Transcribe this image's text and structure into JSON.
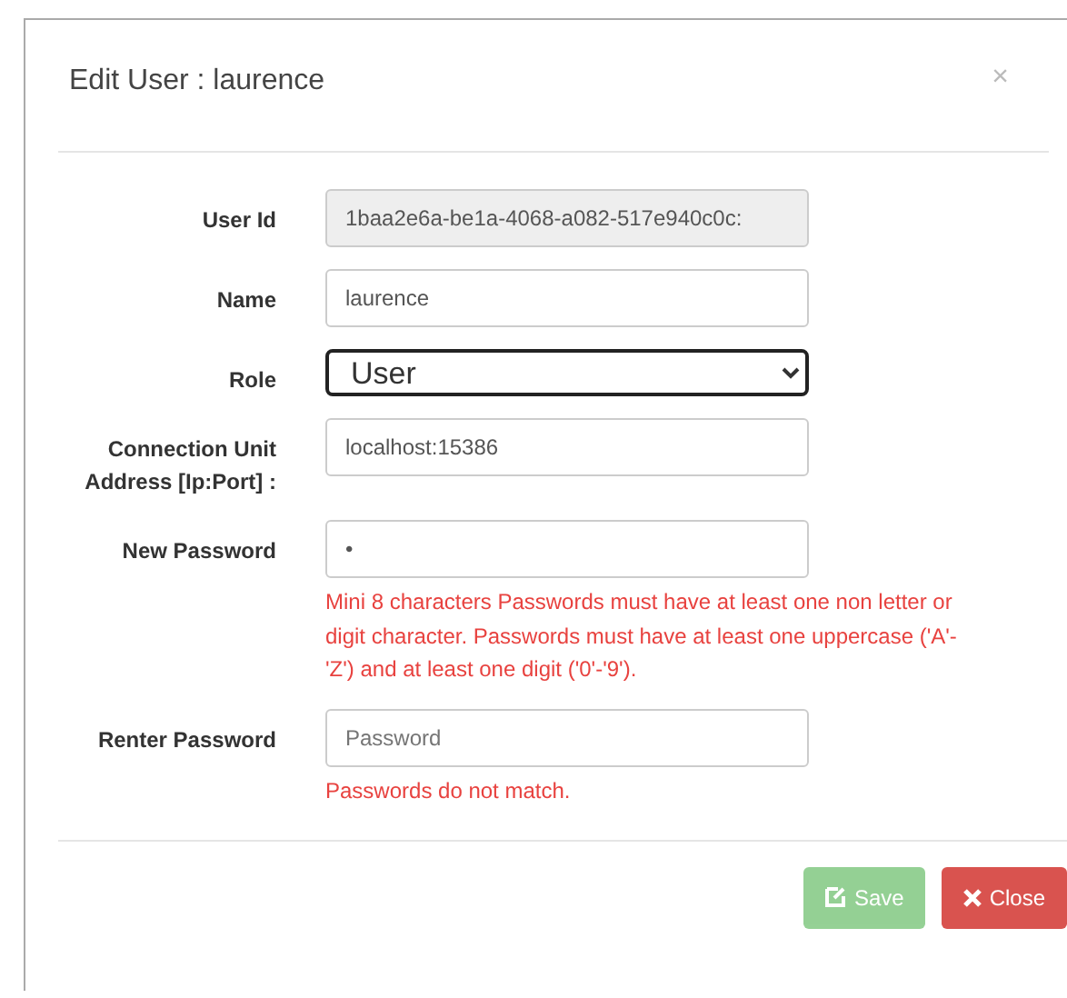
{
  "dialog": {
    "title": "Edit User : laurence",
    "close_glyph": "×"
  },
  "fields": [
    {
      "kind": "readonly",
      "label": "User Id",
      "value": "1baa2e6a-be1a-4068-a082-517e940c0c:"
    },
    {
      "kind": "text",
      "label": "Name",
      "value": "laurence"
    },
    {
      "kind": "select",
      "label": "Role",
      "value": "User",
      "focused": true
    },
    {
      "kind": "text",
      "label": "Connection Unit Address [Ip:Port] :",
      "value": "localhost:15386"
    },
    {
      "kind": "password",
      "label": "New Password",
      "value": "•",
      "error": "Mini 8 characters Passwords must have at least one non letter or digit character. Passwords must have at least one uppercase ('A'-'Z') and at least one digit ('0'-'9')."
    },
    {
      "kind": "password",
      "label": "Renter Password",
      "placeholder": "Password",
      "error": "Passwords do not match."
    }
  ],
  "buttons": [
    {
      "kind": "save",
      "label": "Save",
      "disabled": true
    },
    {
      "kind": "close",
      "label": "Close",
      "disabled": false
    }
  ]
}
